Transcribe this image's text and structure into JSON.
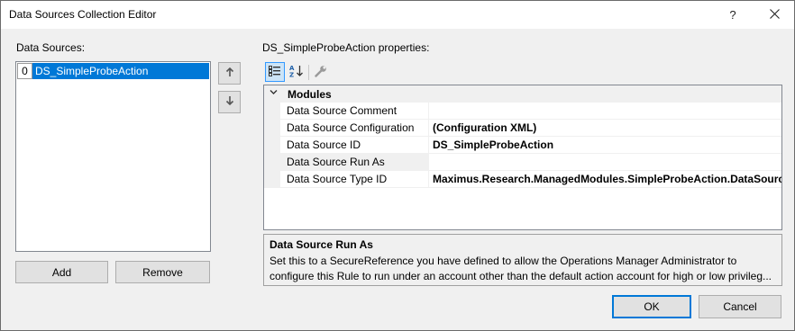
{
  "window": {
    "title": "Data Sources Collection Editor",
    "help_glyph": "?",
    "close_glyph": "✕"
  },
  "left": {
    "label": "Data Sources:",
    "items": [
      {
        "index": "0",
        "name": "DS_SimpleProbeAction",
        "selected": true
      }
    ],
    "move_up_glyph": "🡑",
    "move_down_glyph": "🡓",
    "add_label": "Add",
    "remove_label": "Remove"
  },
  "right": {
    "label": "DS_SimpleProbeAction properties:",
    "toolbar": {
      "categorized_icon": "categorized-icon",
      "alphabetical_icon": "alphabetical-icon",
      "property_pages_icon": "wrench-icon"
    },
    "grid": {
      "category": "Modules",
      "rows": [
        {
          "name": "Data Source Comment",
          "value": ""
        },
        {
          "name": "Data Source Configuration",
          "value": "(Configuration XML)"
        },
        {
          "name": "Data Source ID",
          "value": "DS_SimpleProbeAction"
        },
        {
          "name": "Data Source Run As",
          "value": ""
        },
        {
          "name": "Data Source Type ID",
          "value": "Maximus.Research.ManagedModules.SimpleProbeAction.DataSource"
        }
      ]
    },
    "description": {
      "title": "Data Source Run As",
      "line1": "Set this to a SecureReference you have defined to allow the Operations Manager Administrator to",
      "line2": "configure this Rule to run under an account other than the default action account for high or low privileg..."
    }
  },
  "footer": {
    "ok_label": "OK",
    "cancel_label": "Cancel"
  },
  "colors": {
    "selection": "#0078d7",
    "window_bg": "#f0f0f0"
  }
}
